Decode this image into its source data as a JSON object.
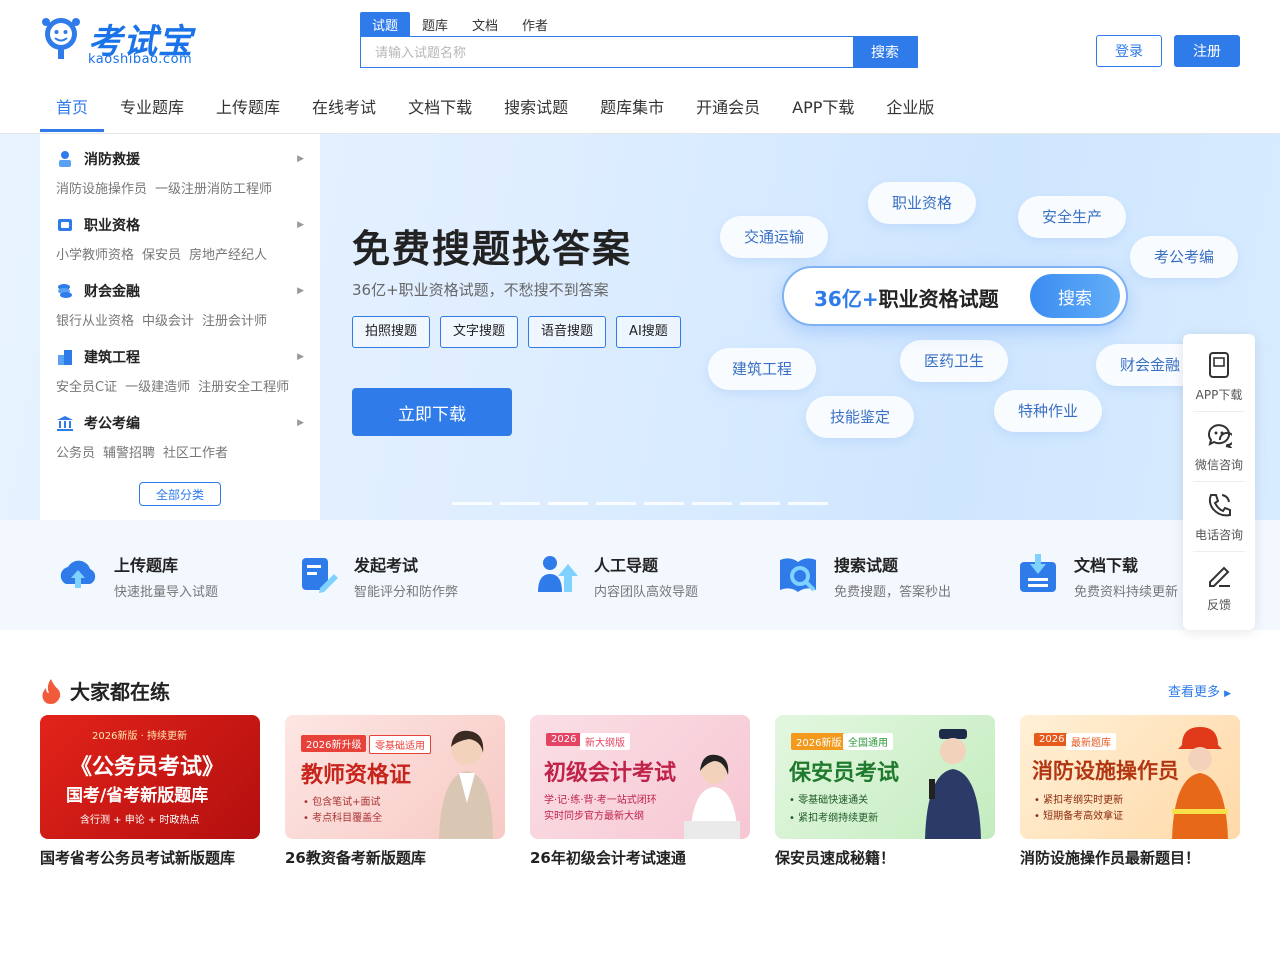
{
  "header": {
    "logo_title": "考试宝",
    "logo_sub": "kaoshibao.com",
    "search_tabs": [
      "试题",
      "题库",
      "文档",
      "作者"
    ],
    "search_placeholder": "请输入试题名称",
    "search_button": "搜索",
    "login": "登录",
    "register": "注册"
  },
  "nav": [
    "首页",
    "专业题库",
    "上传题库",
    "在线考试",
    "文档下载",
    "搜索试题",
    "题库集市",
    "开通会员",
    "APP下载",
    "企业版"
  ],
  "categories": [
    {
      "title": "消防救援",
      "links": [
        "消防设施操作员",
        "一级注册消防工程师"
      ],
      "icon": "firefighter-icon"
    },
    {
      "title": "职业资格",
      "links": [
        "小学教师资格",
        "保安员",
        "房地产经纪人"
      ],
      "icon": "certificate-icon"
    },
    {
      "title": "财会金融",
      "links": [
        "银行从业资格",
        "中级会计",
        "注册会计师"
      ],
      "icon": "coins-icon"
    },
    {
      "title": "建筑工程",
      "links": [
        "安全员C证",
        "一级建造师",
        "注册安全工程师"
      ],
      "icon": "building-icon"
    },
    {
      "title": "考公考编",
      "links": [
        "公务员",
        "辅警招聘",
        "社区工作者"
      ],
      "icon": "government-icon"
    }
  ],
  "all_categories": "全部分类",
  "banner": {
    "title": "免费搜题找答案",
    "subtitle": "36亿+职业资格试题，不愁搜不到答案",
    "tags": [
      "拍照搜题",
      "文字搜题",
      "语音搜题",
      "AI搜题"
    ],
    "download": "立即下载",
    "pill_highlight": "36亿+",
    "pill_text": "职业资格试题",
    "pill_button": "搜索",
    "bubbles": [
      "职业资格",
      "安全生产",
      "交通运输",
      "考公考编",
      "建筑工程",
      "医药卫生",
      "财会金融",
      "技能鉴定",
      "特种作业"
    ]
  },
  "features": [
    {
      "title": "上传题库",
      "sub": "快速批量导入试题",
      "icon": "cloud-upload-icon"
    },
    {
      "title": "发起考试",
      "sub": "智能评分和防作弊",
      "icon": "exam-paper-icon"
    },
    {
      "title": "人工导题",
      "sub": "内容团队高效导题",
      "icon": "person-upload-icon"
    },
    {
      "title": "搜索试题",
      "sub": "免费搜题，答案秒出",
      "icon": "book-search-icon"
    },
    {
      "title": "文档下载",
      "sub": "免费资料持续更新",
      "icon": "doc-download-icon"
    }
  ],
  "side_tools": [
    {
      "label": "APP下载",
      "icon": "phone-icon"
    },
    {
      "label": "微信咨询",
      "icon": "wechat-icon"
    },
    {
      "label": "电话咨询",
      "icon": "call-icon"
    },
    {
      "label": "反馈",
      "icon": "edit-icon"
    }
  ],
  "popular": {
    "title": "大家都在练",
    "more": "查看更多",
    "cards": [
      {
        "name": "国考省考公务员考试新版题库",
        "img_tag": "2026新版 · 持续更新",
        "img_title": "《公务员考试》",
        "img_title2": "国考/省考新版题库",
        "img_line": "含行测 + 申论 + 时政热点"
      },
      {
        "name": "26教资备考新版题库",
        "img_tag": "2026新升级",
        "img_tag2": "零基础适用",
        "img_title": "教师资格证",
        "img_line": "• 包含笔试+面试",
        "img_line2": "• 考点科目覆盖全"
      },
      {
        "name": "26年初级会计考试速通",
        "img_tag": "2026",
        "img_tag2": "新大纲版",
        "img_title": "初级会计考试",
        "img_line": "学·记·练·背·考一站式闭环",
        "img_line2": "实时同步官方最新大纲"
      },
      {
        "name": "保安员速成秘籍！",
        "img_tag": "2026新版",
        "img_tag2": "全国通用",
        "img_title": "保安员考试",
        "img_line": "• 零基础快速通关",
        "img_line2": "• 紧扣考纲持续更新"
      },
      {
        "name": "消防设施操作员最新题目！",
        "img_tag": "2026",
        "img_tag2": "最新题库",
        "img_title": "消防设施操作员",
        "img_line": "• 紧扣考纲实时更新",
        "img_line2": "• 短期备考高效拿证"
      }
    ]
  },
  "colors": {
    "accent": "#2f7bea",
    "banner_bg": "#dfeeff",
    "feature_bg": "#f3f8ff"
  }
}
